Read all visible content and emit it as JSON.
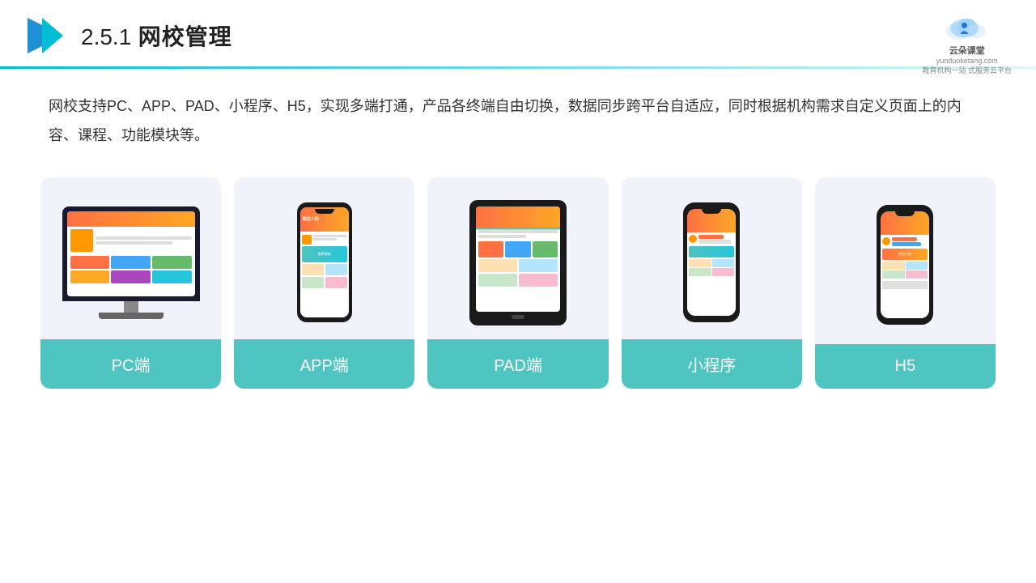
{
  "header": {
    "page_number": "2.5.1",
    "page_title": "网校管理",
    "brand_name": "云朵课堂",
    "brand_url": "yunduoketang.com",
    "brand_tagline": "教育机构一站",
    "brand_tagline2": "式服务云平台"
  },
  "body": {
    "description": "网校支持PC、APP、PAD、小程序、H5，实现多端打通，产品各终端自由切换，数据同步跨平台自适应，同时根据机构需求自定义页面上的内容、课程、功能模块等。"
  },
  "cards": [
    {
      "id": "pc",
      "label": "PC端"
    },
    {
      "id": "app",
      "label": "APP端"
    },
    {
      "id": "pad",
      "label": "PAD端"
    },
    {
      "id": "miniprogram",
      "label": "小程序"
    },
    {
      "id": "h5",
      "label": "H5"
    }
  ],
  "colors": {
    "teal": "#4ec5c1",
    "accent_orange": "#ff7043",
    "brand_blue": "#2196F3"
  }
}
